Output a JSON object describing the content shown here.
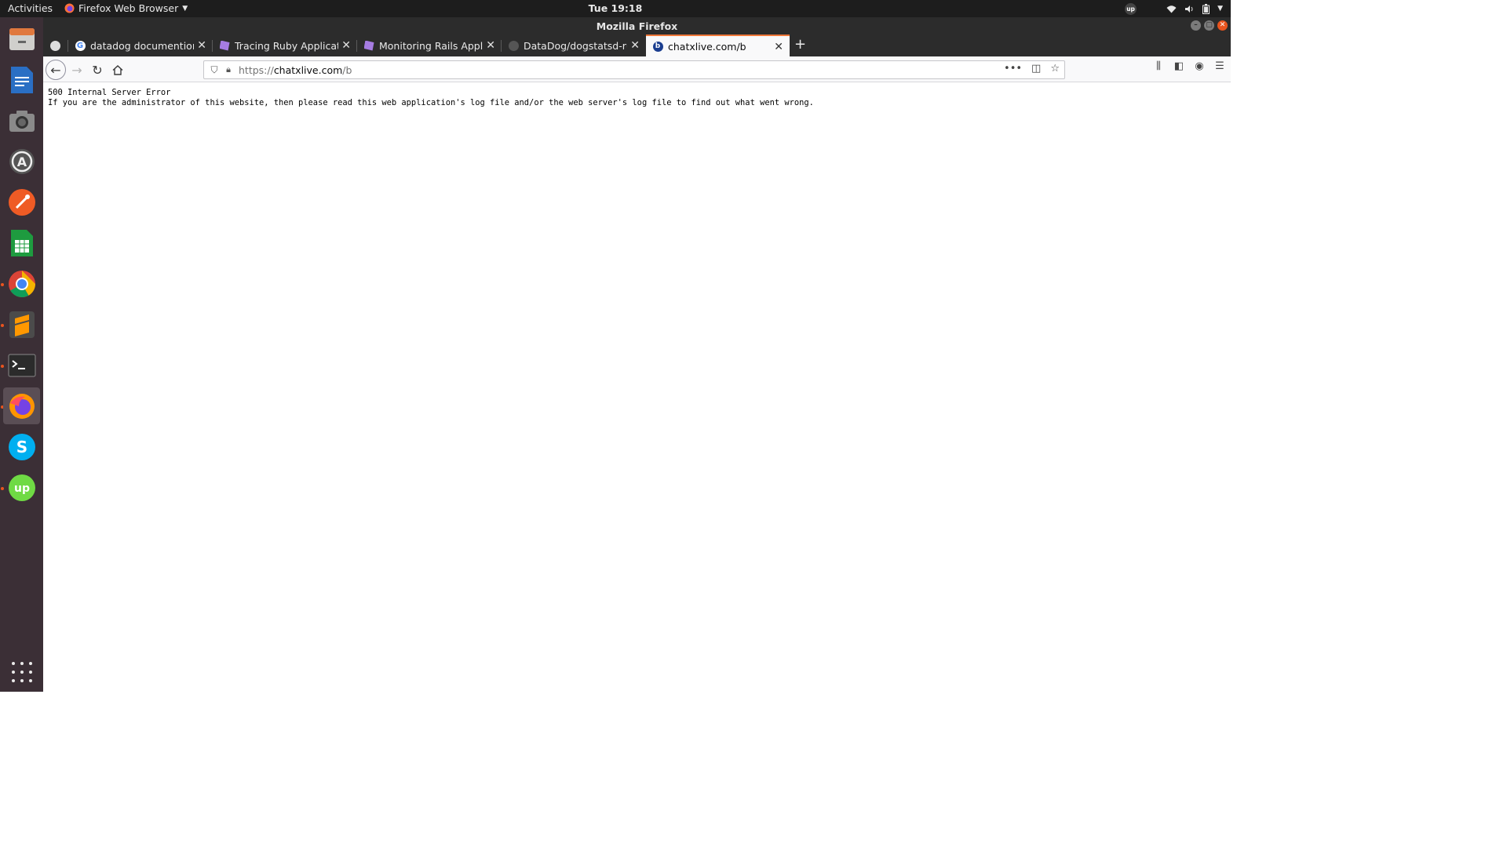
{
  "topbar": {
    "activities": "Activities",
    "app_menu": "Firefox Web Browser",
    "clock": "Tue 19:18",
    "tray_upwork_badge": "up"
  },
  "window": {
    "title": "Mozilla Firefox"
  },
  "tabs": [
    {
      "label": "",
      "favicon": "github-icon"
    },
    {
      "label": "datadog documention ruby",
      "favicon": "google-icon"
    },
    {
      "label": "Tracing Ruby Applications",
      "favicon": "datadog-icon"
    },
    {
      "label": "Monitoring Rails Applications",
      "favicon": "datadog-icon"
    },
    {
      "label": "DataDog/dogstatsd-ruby",
      "favicon": "github-icon"
    },
    {
      "label": "chatxlive.com/b",
      "favicon": "site-b-icon",
      "active": true
    }
  ],
  "urlbar": {
    "protocol": "https://",
    "host": "chatxlive.com",
    "path": "/b"
  },
  "page": {
    "line1": "500 Internal Server Error",
    "line2": "If you are the administrator of this website, then please read this web application's log file and/or the web server's log file to find out what went wrong."
  },
  "dock": {
    "items": [
      "files-icon",
      "writer-icon",
      "screenshot-icon",
      "software-updater-icon",
      "postman-icon",
      "calc-icon",
      "chrome-icon",
      "sublime-icon",
      "terminal-icon",
      "firefox-icon",
      "skype-icon",
      "upwork-icon"
    ]
  },
  "colors": {
    "topbar": "#1d1d1d",
    "dock": "#3b2f36",
    "tabstrip": "#2c2c2c",
    "active_tab_accent": "#f0783a",
    "close_button": "#e9541e"
  }
}
